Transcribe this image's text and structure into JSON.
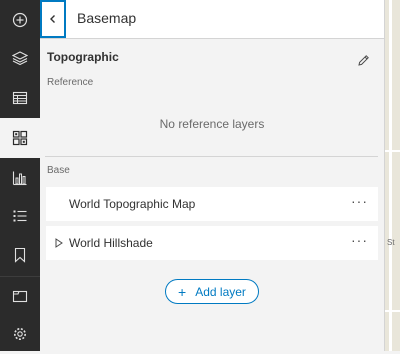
{
  "toolbar": {
    "items": [
      {
        "icon": "add-data-icon"
      },
      {
        "icon": "layers-icon"
      },
      {
        "icon": "table-icon"
      },
      {
        "icon": "basemap-gallery-icon",
        "active": true
      },
      {
        "icon": "charts-icon"
      },
      {
        "icon": "legend-icon"
      },
      {
        "icon": "bookmarks-icon"
      },
      {
        "icon": "folder-icon"
      },
      {
        "icon": "settings-icon"
      }
    ]
  },
  "header": {
    "title": "Basemap"
  },
  "basemap": {
    "name": "Topographic",
    "reference_label": "Reference",
    "reference_empty": "No reference layers",
    "base_label": "Base",
    "base_layers": [
      {
        "name": "World Topographic Map",
        "more": "···"
      },
      {
        "name": "World Hillshade",
        "more": "···"
      }
    ]
  },
  "add_layer": {
    "plus": "+",
    "label": "Add layer"
  },
  "map": {
    "label": "St"
  },
  "colors": {
    "accent": "#007ac2",
    "toolbar_bg": "#2b2b2b",
    "panel_bg": "#f3f3f3",
    "text": "#323232",
    "muted": "#6a6a6a"
  }
}
